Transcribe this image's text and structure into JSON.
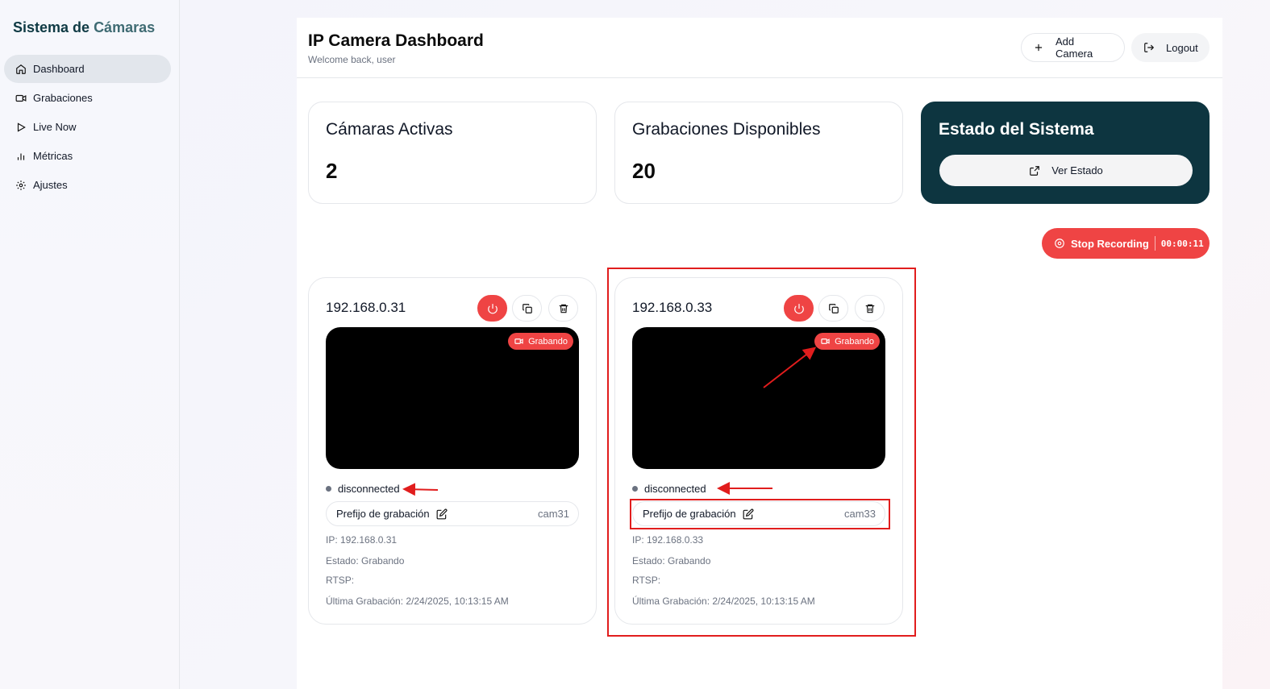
{
  "sidebar": {
    "brand_part1": "Sistema de",
    "brand_part2": "Cámaras",
    "items": [
      {
        "label": "Dashboard",
        "icon": "home-icon",
        "active": true
      },
      {
        "label": "Grabaciones",
        "icon": "video-icon"
      },
      {
        "label": "Live Now",
        "icon": "play-icon"
      },
      {
        "label": "Métricas",
        "icon": "bar-chart-icon"
      },
      {
        "label": "Ajustes",
        "icon": "gear-icon"
      }
    ]
  },
  "header": {
    "title": "IP Camera Dashboard",
    "subtitle": "Welcome back, user",
    "add_label": "Add Camera",
    "logout_label": "Logout"
  },
  "stats": {
    "active_label": "Cámaras Activas",
    "active_value": "2",
    "recordings_label": "Grabaciones Disponibles",
    "recordings_value": "20",
    "system_label": "Estado del Sistema",
    "system_button": "Ver Estado"
  },
  "recording": {
    "stop_label": "Stop Recording",
    "timer": "00:00:11"
  },
  "cameras": [
    {
      "ip": "192.168.0.31",
      "badge": "Grabando",
      "status": "disconnected",
      "prefix_label": "Prefijo de grabación",
      "prefix_value": "cam31",
      "ip_line": "IP: 192.168.0.31",
      "state_line": "Estado: Grabando",
      "rtsp_line": "RTSP:",
      "last_line": "Última Grabación: 2/24/2025, 10:13:15 AM"
    },
    {
      "ip": "192.168.0.33",
      "badge": "Grabando",
      "status": "disconnected",
      "prefix_label": "Prefijo de grabación",
      "prefix_value": "cam33",
      "ip_line": "IP: 192.168.0.33",
      "state_line": "Estado: Grabando",
      "rtsp_line": "RTSP:",
      "last_line": "Última Grabación: 2/24/2025, 10:13:15 AM"
    }
  ],
  "colors": {
    "accent_red": "#ef4444",
    "system_card": "#0d3540",
    "annotation_red": "#e11d1d"
  }
}
